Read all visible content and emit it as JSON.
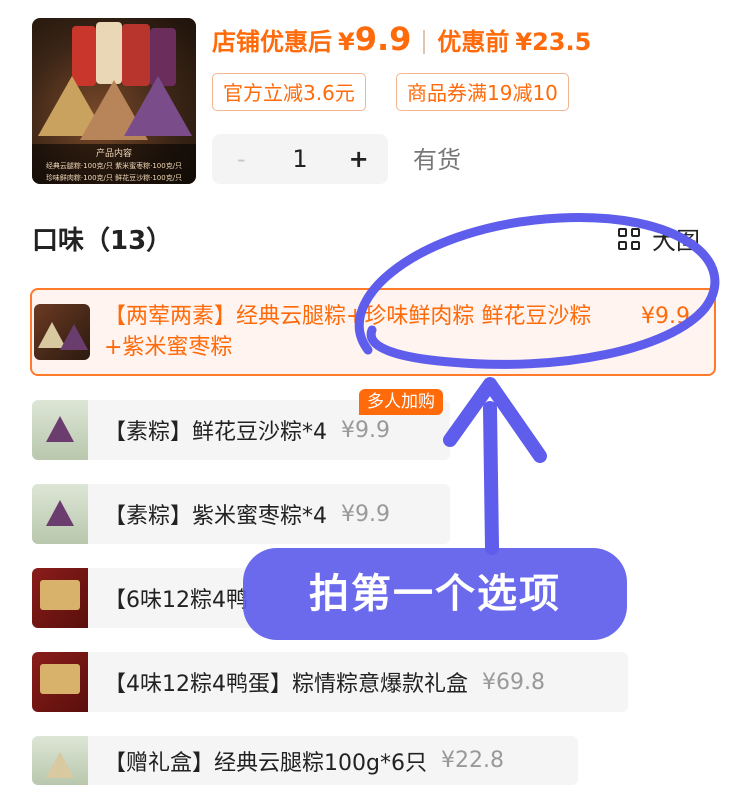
{
  "header": {
    "after_label": "店铺优惠后",
    "after_yen": "¥",
    "after_value": "9.9",
    "before_label": "优惠前",
    "before_value": "¥23.5",
    "tags": [
      "官方立减3.6元",
      "商品券满19减10"
    ],
    "stepper": {
      "minus": "-",
      "qty": "1",
      "plus": "+"
    },
    "stock": "有货",
    "thumb_caption_1": "产品内容",
    "thumb_caption_2": "经典云腿粽·100克/只  紫米蜜枣粽·100克/只",
    "thumb_caption_3": "珍味鲜肉粽·100克/只  鲜花豆沙粽·100克/只"
  },
  "section": {
    "title": "口味（13）",
    "view_toggle": "大图"
  },
  "options": [
    {
      "text": "【两荤两素】经典云腿粽+珍味鲜肉粽 鲜花豆沙粽+紫米蜜枣粽",
      "price": "¥9.9",
      "selected": true
    },
    {
      "text": "【素粽】鲜花豆沙粽*4",
      "price": "¥9.9",
      "badge": "多人加购"
    },
    {
      "text": "【素粽】紫米蜜枣粽*4",
      "price": "¥9.9"
    },
    {
      "text": "【6味12粽4鸭",
      "price": ""
    },
    {
      "text": "【4味12粽4鸭蛋】粽情粽意爆款礼盒",
      "price": "¥69.8"
    },
    {
      "text": "【赠礼盒】经典云腿粽100g*6只",
      "price": "¥22.8"
    }
  ],
  "overlay": {
    "instruction": "拍第一个选项"
  },
  "colors": {
    "accent": "#ff6a0a",
    "annotation": "#5e5dec",
    "selected_bg": "#fff4ef"
  }
}
